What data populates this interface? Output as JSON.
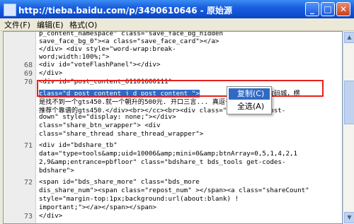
{
  "window": {
    "title": "http://tieba.baidu.com/p/3490610646 - 原始源",
    "min_label": "_",
    "max_label": "□",
    "close_label": "✕"
  },
  "menu": {
    "file": "文件(F)",
    "edit": "编辑(E)",
    "format": "格式(O)"
  },
  "gutter": {
    "l68": "68",
    "l69": "69",
    "l70": "70",
    "l71": "71",
    "l72": "72",
    "l73": "73"
  },
  "code": {
    "line0": "p_content_namespace\" class=\"save_face_bg_hidden",
    "line1": "save_face_bg_0\"><a class=\"save_face_card\"></a>",
    "line2": "</div>                <div style=\"word-wrap:break-",
    "line3": "word;width:100%;\">",
    "line4": "                <div id=\"voteFlashPanel\"></div>",
    "line5": "            </div>",
    "line6": "            <div id=\"post_content_61101600111\"",
    "line7": "class=\"d_post_content j_d_post_content \">",
    "line7b": "跑遍数码城，楞",
    "line8": "是找不到一个gts450.就一个朝升的500元. 开口三言...  真逗子。大能谁给",
    "line9": "推荐个靠谱的gts450.</div><br></cc><br><div class=\"post-hide-post-",
    "line10": "down\" style=\"display: none;\"></div>",
    "line11": "class=\"share_btn_wrapper\">          <div",
    "line12": "class=\"share_thread share_thread_wrapper\">",
    "line13": "            <div id=\"bdshare_tb\"",
    "line14": "data=\"type=tools&amp;uid=10006&amp;mini=0&amp;btnArray=0,5,1,4,2,1",
    "line15": "2,9&amp;entrance=pbfloor\" class=\"bdshare_t bds_tools get-codes-",
    "line16": "bdshare\">",
    "line17": "                <span id=\"bds_share_more\" class=\"bds_more",
    "line18": "dis_share_num\"><span class=\"repost_num\" ></span><a class=\"shareCount\"",
    "line19": "style=\"margin-top:1px;background:url(about:blank) !",
    "line20": "important;\"></a></span></span>",
    "line21": "            </div>"
  },
  "context_menu": {
    "copy": "复制(C)",
    "select_all": "全选(A)"
  },
  "scrollbar": {
    "up": "▲",
    "down": "▼"
  }
}
